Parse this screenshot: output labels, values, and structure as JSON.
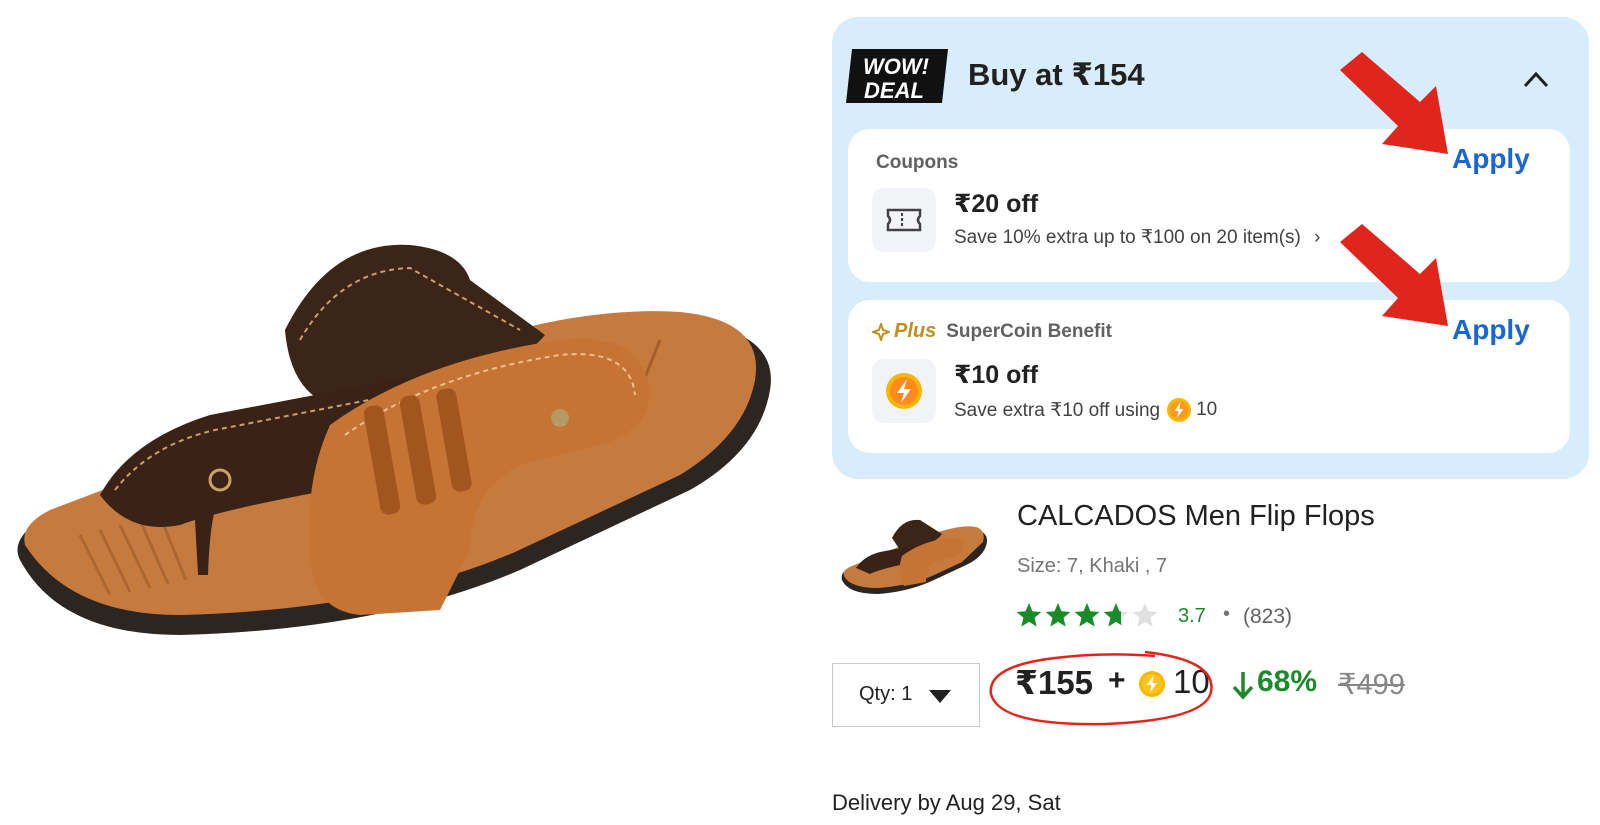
{
  "deal": {
    "badge_line1": "WOW!",
    "badge_line2": "DEAL",
    "title": "Buy at ₹154",
    "toggle_icon": "chevron-up-icon"
  },
  "coupon": {
    "label": "Coupons",
    "apply": "Apply",
    "amount": "₹20 off",
    "description": "Save 10% extra up to ₹100 on 20 item(s)",
    "icon": "ticket-icon"
  },
  "supercoin": {
    "plus": "Plus",
    "label": "SuperCoin Benefit",
    "apply": "Apply",
    "amount": "₹10 off",
    "description": "Save extra ₹10 off using",
    "coins": "10",
    "icon": "supercoin-icon"
  },
  "product": {
    "name": "CALCADOS Men Flip Flops",
    "size": "Size: 7, Khaki , 7",
    "rating": "3.7",
    "rating_separator": "•",
    "rating_count": "(823)",
    "stars_value": 3.7,
    "stars_max": 5
  },
  "pricing": {
    "qty_label": "Qty: 1",
    "price": "₹155",
    "plus": "+",
    "coins": "10",
    "discount": "68%",
    "mrp": "₹499"
  },
  "delivery": {
    "text": "Delivery by Aug 29, Sat"
  },
  "colors": {
    "panel_bg": "#d7edfb",
    "apply_blue": "#1a66d6",
    "rating_green": "#1b8a2a",
    "annotation_red": "#e0261c",
    "coin_yellow": "#f5b800"
  }
}
